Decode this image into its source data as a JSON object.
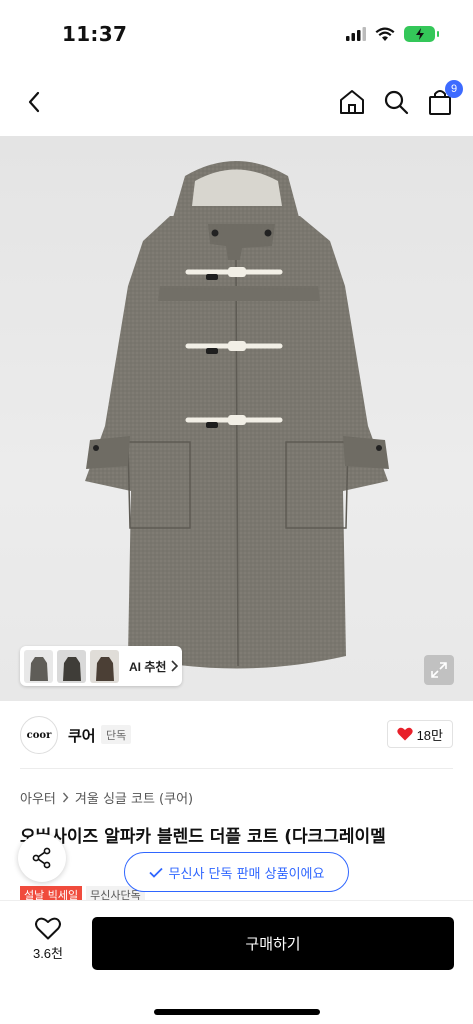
{
  "status_bar": {
    "time": "11:37",
    "icons": [
      "signal-icon",
      "wifi-icon",
      "battery-charging-icon"
    ]
  },
  "nav": {
    "back_icon": "chevron-left-icon",
    "home_icon": "home-icon",
    "search_icon": "search-icon",
    "cart_icon": "shopping-bag-icon",
    "cart_count": "9"
  },
  "product_image": {
    "ai_recommend_label": "AI 추천",
    "expand_icon": "expand-icon"
  },
  "brand": {
    "logo_text": "coor",
    "name": "쿠어",
    "tag": "단독",
    "like_count": "18만"
  },
  "breadcrumb": {
    "category": "아우터",
    "subcategory": "겨울 싱글 코트 (쿠어)"
  },
  "product": {
    "title": "오버사이즈 알파카 블렌드 더플 코트 (다크그레이멜",
    "exclusive_notice": "무신사 단독 판매 상품이에요",
    "tags": [
      "설날 빅세일",
      "무신사단독"
    ]
  },
  "bottom_bar": {
    "wish_count": "3.6천",
    "buy_label": "구매하기"
  },
  "colors": {
    "accent_blue": "#2f66ff",
    "badge_blue": "#3d6bff",
    "sale_red": "#f04b3c",
    "heart_red": "#e8202a",
    "coat_gray": "#7a776f"
  }
}
